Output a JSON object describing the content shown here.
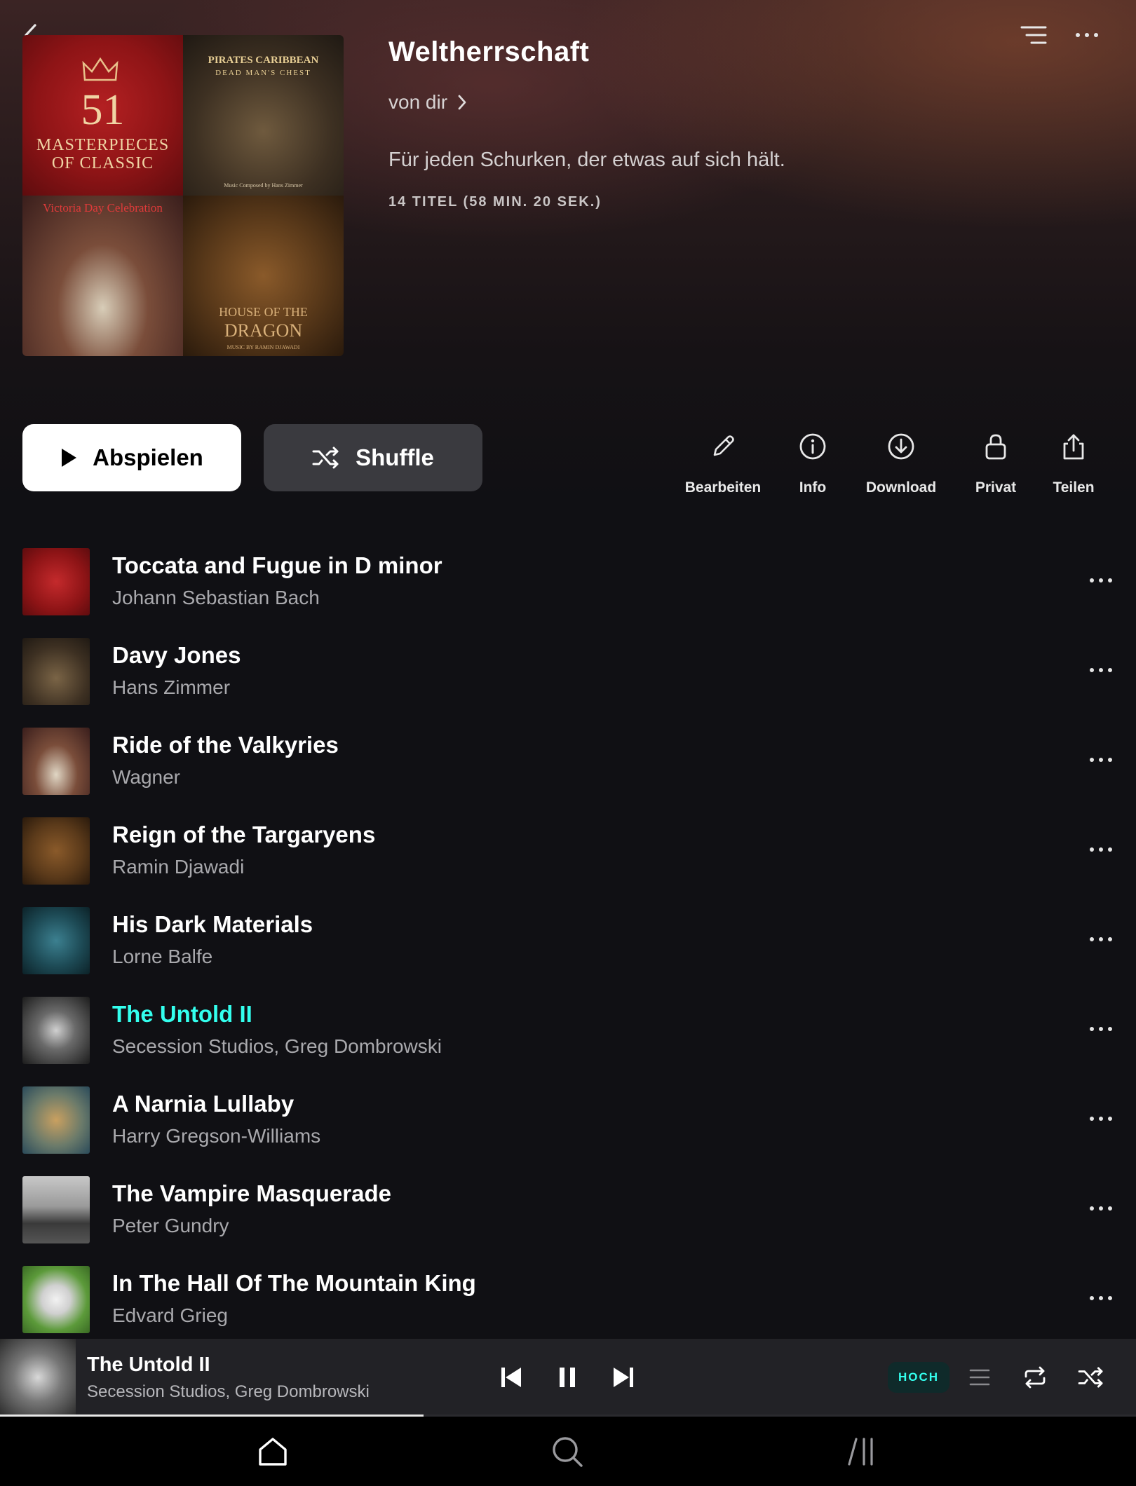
{
  "header": {
    "title": "Weltherrschaft",
    "owner_label": "von dir",
    "description": "Für jeden Schurken, der etwas auf sich hält.",
    "meta": "14 TITEL (58 MIN. 20 SEK.)",
    "icons": {
      "back": "chevron-left-icon",
      "sort": "sort-lines-icon",
      "more": "more-horizontal-icon"
    }
  },
  "cover": {
    "tile1": {
      "line1": "51",
      "line2": "MASTERPIECES",
      "line3": "OF CLASSIC"
    },
    "tile2": {
      "line1": "PIRATES CARIBBEAN",
      "line2": "DEAD MAN'S CHEST",
      "line3": "Music Composed by Hans Zimmer"
    },
    "tile3": {
      "line1": "Victoria Day Celebration"
    },
    "tile4": {
      "line1": "HOUSE OF THE",
      "line2": "DRAGON",
      "line3": "MUSIC BY RAMIN DJAWADI"
    }
  },
  "buttons": {
    "play_label": "Abspielen",
    "shuffle_label": "Shuffle"
  },
  "actions": [
    {
      "label": "Bearbeiten",
      "icon": "pencil-icon"
    },
    {
      "label": "Info",
      "icon": "info-icon"
    },
    {
      "label": "Download",
      "icon": "download-icon"
    },
    {
      "label": "Privat",
      "icon": "lock-icon"
    },
    {
      "label": "Teilen",
      "icon": "share-icon"
    }
  ],
  "tracks": [
    {
      "title": "Toccata and Fugue in D minor",
      "artist": "Johann Sebastian Bach",
      "thumb_color": "#9b1518"
    },
    {
      "title": "Davy Jones",
      "artist": "Hans Zimmer",
      "thumb_color": "#4a3a28"
    },
    {
      "title": "Ride of the Valkyries",
      "artist": "Wagner",
      "thumb_color": "#5a2e2a"
    },
    {
      "title": "Reign of the Targaryens",
      "artist": "Ramin Djawadi",
      "thumb_color": "#5e3b1b"
    },
    {
      "title": "His Dark Materials",
      "artist": "Lorne Balfe",
      "thumb_color": "#1d4a55"
    },
    {
      "title": "The Untold II",
      "artist": "Secession Studios, Greg Dombrowski",
      "thumb_color": "#1c1c1c",
      "playing": true
    },
    {
      "title": "A Narnia Lullaby",
      "artist": "Harry Gregson-Williams",
      "thumb_color": "#6a7a6a"
    },
    {
      "title": "The Vampire Masquerade",
      "artist": "Peter Gundry",
      "thumb_color": "#9a9a9a"
    },
    {
      "title": "In The Hall Of The Mountain King",
      "artist": "Edvard Grieg",
      "thumb_color": "#5c9a3a"
    }
  ],
  "now_playing": {
    "title": "The Untold II",
    "artist": "Secession Studios, Greg Dombrowski",
    "quality": "HOCH",
    "progress": 0.373,
    "is_playing": true
  },
  "nav": [
    {
      "name": "home",
      "icon": "home-icon"
    },
    {
      "name": "search",
      "icon": "search-icon"
    },
    {
      "name": "library",
      "icon": "library-icon"
    }
  ],
  "colors": {
    "accent": "#33ffee",
    "background": "#101014",
    "player_bg": "#222226"
  }
}
